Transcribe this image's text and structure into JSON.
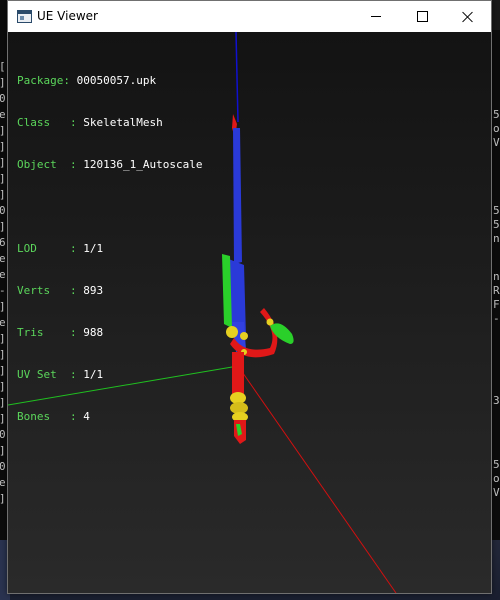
{
  "window": {
    "title": "UE Viewer"
  },
  "titlebar_icons": {
    "app": "app-window-icon",
    "minimize": "minimize-icon",
    "maximize": "maximize-icon",
    "close": "close-icon"
  },
  "info": {
    "package_label": "Package: ",
    "package_value": "00050057.upk",
    "class_label": "Class   : ",
    "class_value": "SkeletalMesh",
    "object_label": "Object  : ",
    "object_value": "120136_1_Autoscale",
    "lod_label": "LOD     : ",
    "lod_value": "1/1",
    "verts_label": "Verts   : ",
    "verts_value": "893",
    "tris_label": "Tris    : ",
    "tris_value": "988",
    "uvset_label": "UV Set  : ",
    "uvset_value": "1/1",
    "bones_label": "Bones   : ",
    "bones_value": "4"
  },
  "colors": {
    "info_key": "#5bd65b",
    "info_value": "#ffffff",
    "axis_x": "#d01010",
    "axis_y": "#20c020",
    "axis_z": "#1010d0",
    "mesh_blue": "#2a3ad8",
    "mesh_green": "#2ad02a",
    "mesh_red": "#e01818",
    "mesh_yellow": "#e6d020"
  },
  "background_console": {
    "left_chars": [
      "[",
      "]",
      "0",
      "e",
      "]",
      "]",
      "]",
      "]",
      "]",
      "0",
      "]",
      "6",
      "e",
      "e",
      "-",
      "]",
      "e",
      "]",
      "]",
      "]",
      "]",
      "]",
      "]",
      "0",
      "]",
      "0",
      "e",
      "]"
    ],
    "right_chars": [
      "5",
      "o",
      "V",
      "5",
      "5",
      "n",
      "n",
      "R",
      "F",
      "-",
      "3",
      "5",
      "o",
      "V"
    ]
  }
}
